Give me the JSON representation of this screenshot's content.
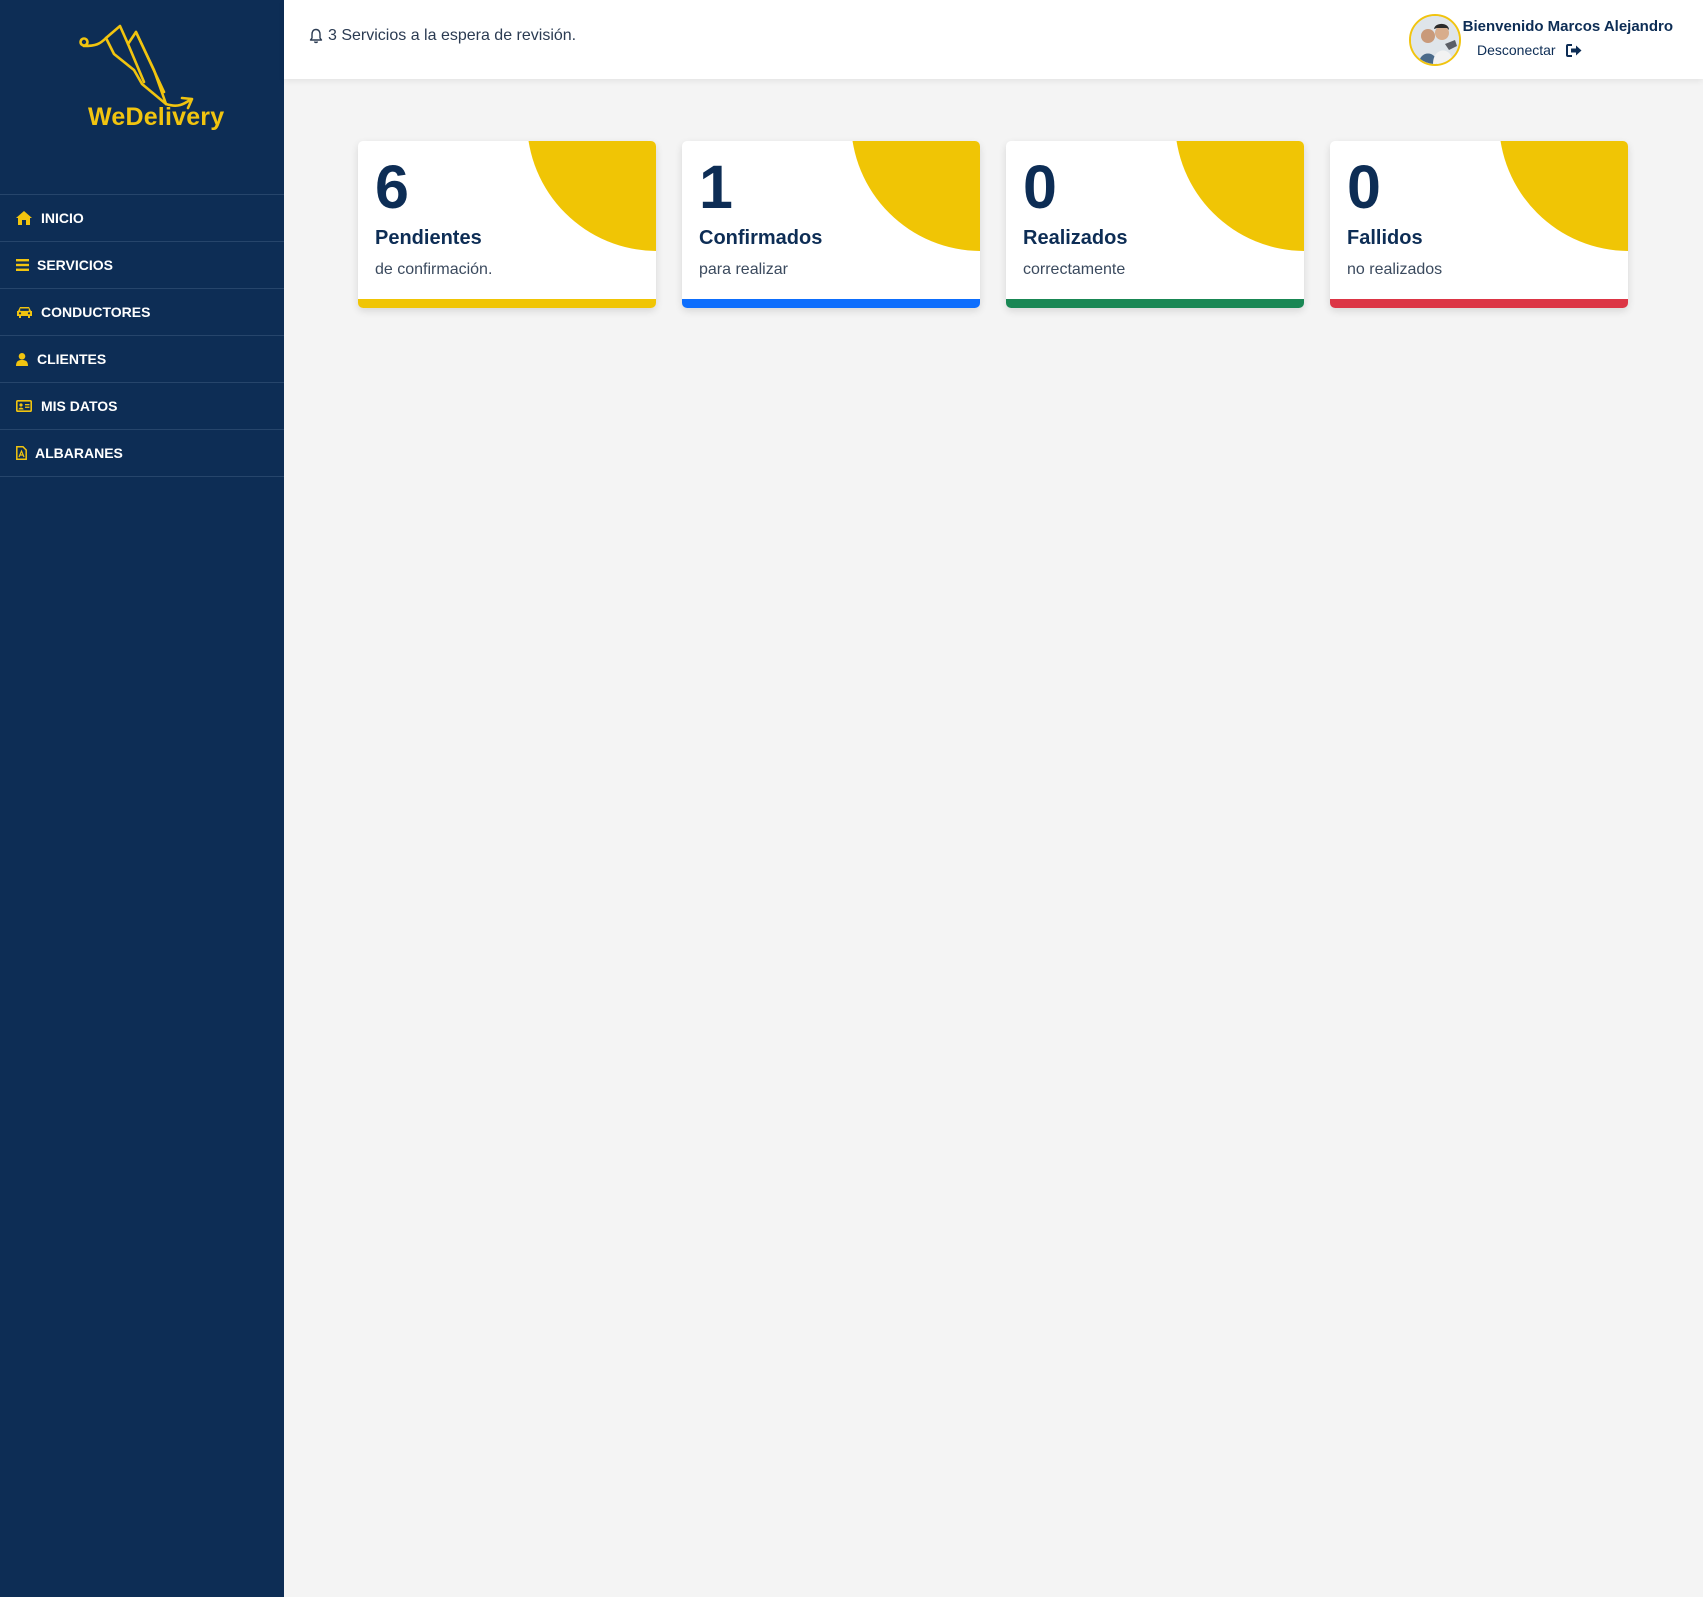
{
  "brand": {
    "name": "WeDelivery",
    "color": "#f1c40f"
  },
  "sidebar": {
    "items": [
      {
        "label": "INICIO",
        "icon": "home-icon"
      },
      {
        "label": "SERVICIOS",
        "icon": "list-icon"
      },
      {
        "label": "CONDUCTORES",
        "icon": "car-icon"
      },
      {
        "label": "CLIENTES",
        "icon": "user-icon"
      },
      {
        "label": "MIS DATOS",
        "icon": "id-card-icon"
      },
      {
        "label": "ALBARANES",
        "icon": "pdf-file-icon"
      }
    ]
  },
  "header": {
    "notification": "3 Servicios a la espera de revisión.",
    "welcome": "Bienvenido Marcos Alejandro",
    "logout": "Desconectar"
  },
  "cards": [
    {
      "count": "6",
      "title": "Pendientes",
      "subtitle": "de confirmación.",
      "bar_color": "#f0c505"
    },
    {
      "count": "1",
      "title": "Confirmados",
      "subtitle": "para realizar",
      "bar_color": "#0d6efd"
    },
    {
      "count": "0",
      "title": "Realizados",
      "subtitle": "correctamente",
      "bar_color": "#198754"
    },
    {
      "count": "0",
      "title": "Fallidos",
      "subtitle": "no realizados",
      "bar_color": "#dc3545"
    }
  ],
  "colors": {
    "sidebar_bg": "#0d2d55",
    "accent": "#f0c505",
    "page_bg": "#f4f4f4"
  }
}
